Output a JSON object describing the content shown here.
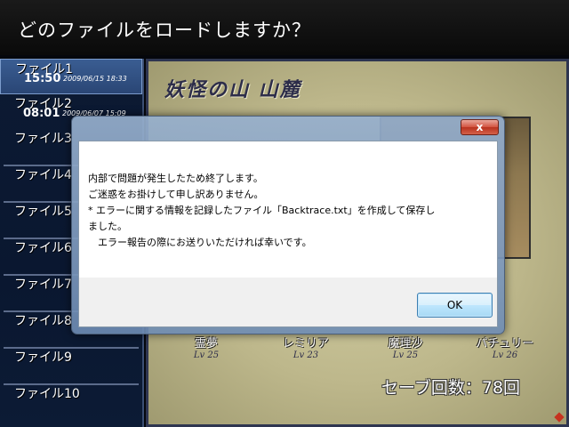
{
  "game": {
    "prompt": "どのファイルをロードしますか？",
    "files": [
      {
        "label": "ファイル1",
        "time": "15:50",
        "date": "2009/06/15 18:33"
      },
      {
        "label": "ファイル2",
        "time": "08:01",
        "date": "2009/06/07 15:09"
      },
      {
        "label": "ファイル3"
      },
      {
        "label": "ファイル4"
      },
      {
        "label": "ファイル5"
      },
      {
        "label": "ファイル6"
      },
      {
        "label": "ファイル7"
      },
      {
        "label": "ファイル8"
      },
      {
        "label": "ファイル9"
      },
      {
        "label": "ファイル10"
      }
    ],
    "location": "妖怪の山 山麓",
    "party": [
      {
        "name": "霊夢",
        "level": "Lv 25"
      },
      {
        "name": "レミリア",
        "level": "Lv 23"
      },
      {
        "name": "魔理沙",
        "level": "Lv 25"
      },
      {
        "name": "パチュリー",
        "level": "Lv 26"
      }
    ],
    "save_count": "セーブ回数：78回"
  },
  "dialog": {
    "close_glyph": "x",
    "message_lines": [
      "内部で問題が発生したため終了します。",
      "ご迷惑をお掛けして申し訳ありません。",
      "* エラーに関する情報を記録したファイル「Backtrace.txt」を作成して保存し",
      "ました。",
      "　エラー報告の際にお送りいただければ幸いです。"
    ],
    "ok_label": "OK"
  },
  "colors": {
    "list_bg": "#0c1a33",
    "selected_slot": "#3a5d92",
    "preview_bg": "#c8c397",
    "close_button": "#c8402c",
    "ok_button_border": "#3c7fb1"
  }
}
